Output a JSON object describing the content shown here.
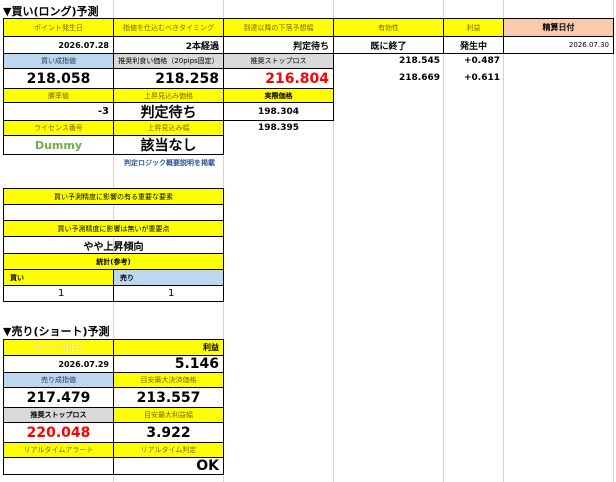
{
  "buy": {
    "title": "▼買い(ロング)予測",
    "h_point_date": "ポイント発生日",
    "h_timing": "指値を仕込むべきタイミング",
    "h_lower_bound": "到達以降の下落予想幅",
    "h_valid": "有効性",
    "h_profit": "利益",
    "h_settle_date": "精算日付",
    "point_date": "2026.07.28",
    "timing": "2本経過",
    "lower_status": "判定待ち",
    "valid": "既に終了",
    "profit_status": "発生中",
    "settle_date": "2026.07.30",
    "l_buy_limit": "買い成指値",
    "l_recommended_buy": "推奨利食い価格（20pips固定）",
    "l_recommended_stop": "推奨ストップロス",
    "buy_limit": "218.058",
    "recommended_buy": "218.258",
    "recommended_stop": "216.804",
    "side_a1": "218.545",
    "side_a2": "+0.487",
    "side_b1": "218.669",
    "side_b2": "+0.611",
    "l_signal": "勝率値",
    "l_upper_add": "上昇見込み価格",
    "l_result_price": "実際価格",
    "signal": "-3",
    "upper_status": "判定待ち",
    "result_price_1": "198.304",
    "l_license": "ライセンス番号",
    "l_upper_ext": "上昇見込み幅",
    "result_price_2": "198.395",
    "license": "Dummy",
    "applicable": "該当なし",
    "link": "判定ロジック概要説明を掲載"
  },
  "factors": {
    "q1": "買い予測精度に影響の有る重要な要素",
    "q2": "買い予測精度に影響は無いが重要点",
    "trend": "やや上昇傾向",
    "stats_header": "統計(参考)",
    "col_buy": "買い",
    "col_sell": "売り",
    "buy_count": "1",
    "sell_count": "1"
  },
  "sell": {
    "title": "▼売り(ショート)予測",
    "h_point_date": "ポイント発生日",
    "h_profit": "利益",
    "point_date": "2026.07.29",
    "profit": "5.146",
    "l_sell_limit": "売り成指値",
    "l_target_settle": "目安最大決済価格",
    "sell_limit": "217.479",
    "target_settle": "213.557",
    "l_stop": "推奨ストップロス",
    "l_target_profit": "目安最大利益幅",
    "stop": "220.048",
    "target_profit": "3.922",
    "l_alert": "リアルタイムアラート",
    "l_rt_judge": "リアルタイム判定",
    "rt_judge": "OK"
  }
}
